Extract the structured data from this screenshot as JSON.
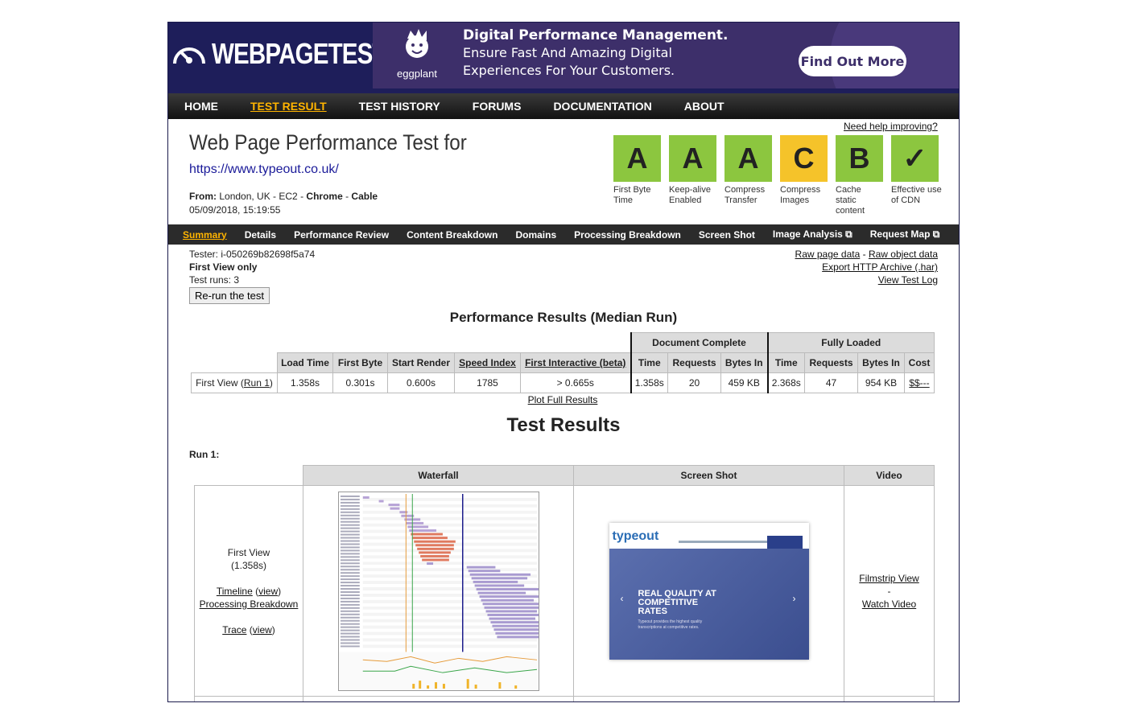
{
  "logo": {
    "text": "WEBPAGETEST"
  },
  "banner": {
    "brand": "eggplant",
    "line1": "Digital Performance Management.",
    "line2": "Ensure Fast And Amazing Digital",
    "line3": "Experiences For Your Customers.",
    "cta": "Find Out More"
  },
  "nav": [
    "HOME",
    "TEST RESULT",
    "TEST HISTORY",
    "FORUMS",
    "DOCUMENTATION",
    "ABOUT"
  ],
  "title": "Web Page Performance Test for",
  "url": "https://www.typeout.co.uk/",
  "from": {
    "label": "From:",
    "location": "London, UK - EC2 - ",
    "browser": "Chrome",
    "sep": " - ",
    "connection": "Cable"
  },
  "date": "05/09/2018, 15:19:55",
  "help_link": "Need help improving?",
  "grades": [
    {
      "grade": "A",
      "label": "First Byte Time"
    },
    {
      "grade": "A",
      "label": "Keep-alive Enabled"
    },
    {
      "grade": "A",
      "label": "Compress Transfer"
    },
    {
      "grade": "C",
      "label": "Compress Images"
    },
    {
      "grade": "B",
      "label": "Cache static content"
    },
    {
      "grade": "✓",
      "label": "Effective use of CDN"
    }
  ],
  "subnav": [
    "Summary",
    "Details",
    "Performance Review",
    "Content Breakdown",
    "Domains",
    "Processing Breakdown",
    "Screen Shot",
    "Image Analysis ⧉",
    "Request Map ⧉"
  ],
  "tester": "Tester: i-050269b82698f5a74",
  "first_view_only": "First View only",
  "test_runs": "Test runs: 3",
  "rerun": "Re-run the test",
  "right_links": {
    "raw_page": "Raw page data",
    "dash": " - ",
    "raw_object": "Raw object data",
    "export": "Export HTTP Archive (.har)",
    "log": "View Test Log"
  },
  "perf": {
    "heading": "Performance Results (Median Run)",
    "group_doc": "Document Complete",
    "group_full": "Fully Loaded",
    "headers": [
      "Load Time",
      "First Byte",
      "Start Render",
      "Speed Index",
      "First Interactive (beta)",
      "Time",
      "Requests",
      "Bytes In",
      "Time",
      "Requests",
      "Bytes In",
      "Cost"
    ],
    "row_label": "First View (",
    "row_link": "Run 1",
    "row_end": ")",
    "values": [
      "1.358s",
      "0.301s",
      "0.600s",
      "1785",
      "> 0.665s",
      "1.358s",
      "20",
      "459 KB",
      "2.368s",
      "47",
      "954 KB",
      "$$---"
    ]
  },
  "plot_full": "Plot Full Results",
  "results_heading": "Test Results",
  "run_label": "Run 1:",
  "results": {
    "headers": [
      "Waterfall",
      "Screen Shot",
      "Video"
    ],
    "first_view": "First View",
    "first_view_time": "(1.358s)",
    "timeline": "Timeline",
    "view": "view",
    "processing": "Processing Breakdown",
    "trace": "Trace",
    "filmstrip": "Filmstrip View",
    "dash": "-",
    "watch": "Watch Video"
  },
  "screenshot": {
    "brand": "typeout",
    "headline1": "REAL QUALITY AT",
    "headline2": "COMPETITIVE",
    "headline3": "RATES",
    "sub": "Typeout provides the highest quality transcriptions at competitive rates."
  },
  "colors": {
    "header": "#1e1e5a",
    "banner": "#3d2f6a",
    "grade_good": "#8cc63f",
    "grade_mid": "#f5c32a",
    "active": "#ffb400"
  }
}
